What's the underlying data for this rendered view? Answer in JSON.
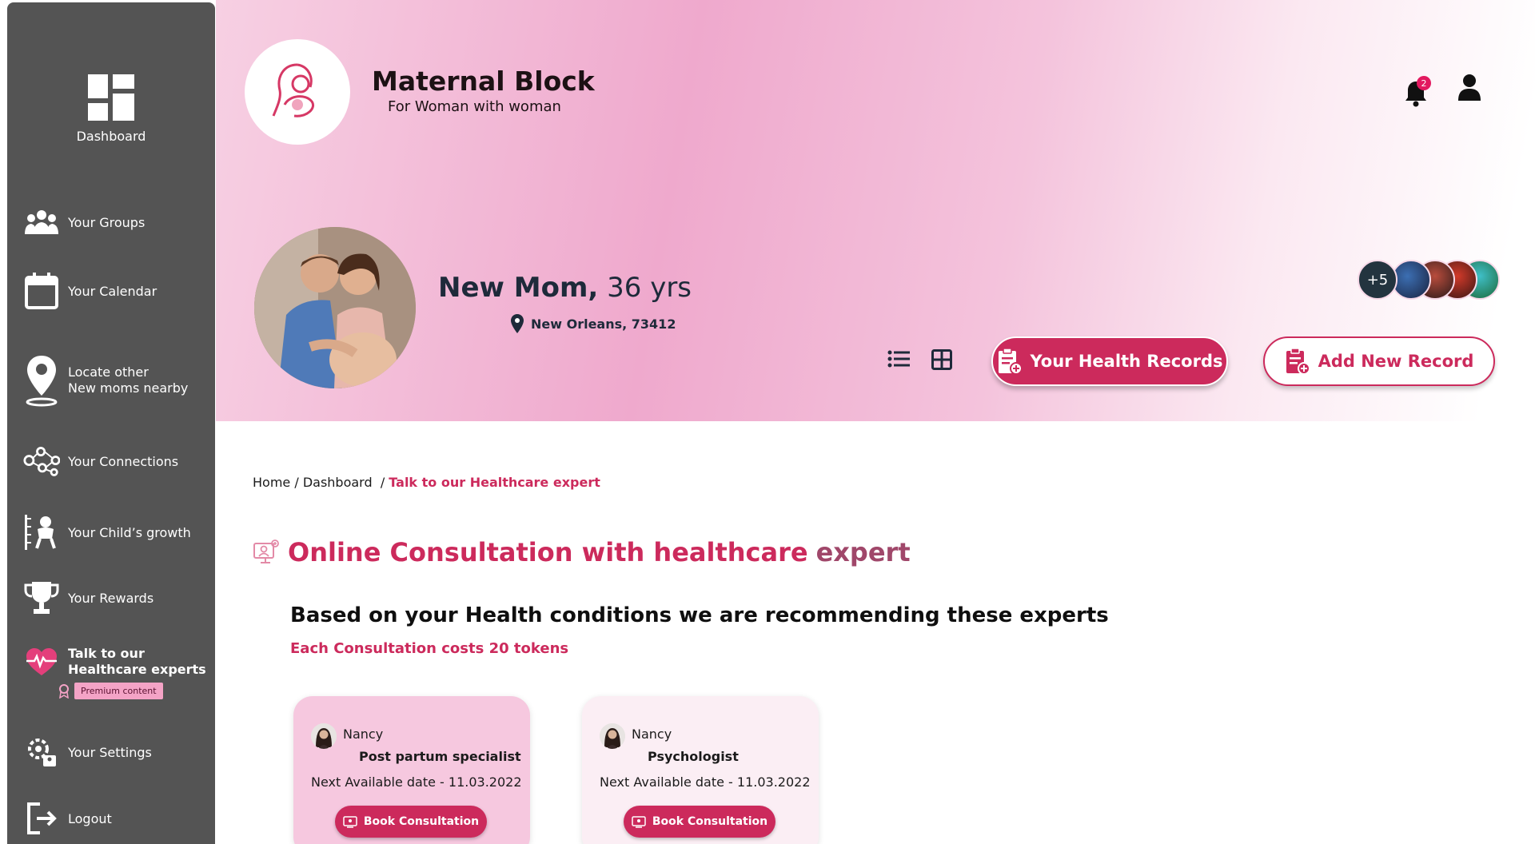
{
  "sidebar": {
    "dashboard_label": "Dashboard",
    "items": [
      {
        "label": "Your Groups",
        "icon": "groups-icon"
      },
      {
        "label": "Your Calendar",
        "icon": "calendar-icon"
      },
      {
        "label": "Locate other\nNew moms nearby",
        "icon": "location-pin-icon"
      },
      {
        "label": "Your Connections",
        "icon": "connections-icon"
      },
      {
        "label": "Your Child’s growth",
        "icon": "baby-growth-icon"
      },
      {
        "label": "Your Rewards",
        "icon": "trophy-icon"
      },
      {
        "label": "Talk to our\nHealthcare experts",
        "icon": "heart-pulse-icon"
      },
      {
        "label": "Your  Settings",
        "icon": "settings-icon"
      },
      {
        "label": "Logout",
        "icon": "logout-icon"
      }
    ],
    "premium_label": "Premium content"
  },
  "header": {
    "brand_name": "Maternal Block",
    "brand_tagline": "For Woman with woman",
    "notification_count": "2"
  },
  "profile": {
    "name": "New Mom,",
    "age": "36 yrs",
    "location": "New Orleans, 73412",
    "more_connections": "+5"
  },
  "actions": {
    "health_records": "Your Health Records",
    "add_record": "Add New Record"
  },
  "breadcrumb": {
    "home": "Home",
    "dashboard": "Dashboard",
    "current": "Talk to our Healthcare expert"
  },
  "content": {
    "title_part1": "Online Consultation with healthcare",
    "title_part2": "expert",
    "recommend": "Based on your Health conditions we are recommending these experts",
    "cost": "Each Consultation costs 20 tokens"
  },
  "experts": [
    {
      "name": "Nancy",
      "role": "Post partum specialist",
      "next": "Next Available  date - 11.03.2022",
      "button": "Book Consultation"
    },
    {
      "name": "Nancy",
      "role": "Psychologist",
      "next": "Next Available  date - 11.03.2022",
      "button": "Book Consultation"
    }
  ],
  "colors": {
    "accent": "#cc2a5c",
    "sidebar": "#545454",
    "hero_pink": "#efa9cd"
  }
}
